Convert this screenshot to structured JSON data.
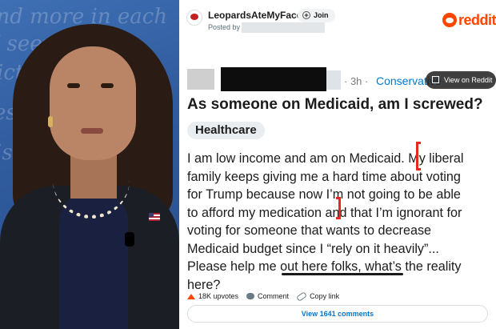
{
  "post": {
    "subreddit": "LeopardsAteMyFace",
    "join_label": "Join",
    "posted_by_label": "Posted by",
    "time_ago": "· 3h ·",
    "flair_subreddit": "Conservative",
    "view_on_reddit": "View on Reddit",
    "brand": "reddit",
    "title": "As someone on Medicaid, am I screwed?",
    "tag": "Healthcare",
    "body_lines": [
      "I am low income and am on Medicaid. My liberal",
      "family keeps giving me a hard time about voting",
      "for Trump because now I’m not going to be able",
      "to afford my medication and that I’m ignorant for",
      "voting for someone that wants to decrease",
      "Medicaid budget since I “rely on it heavily”...",
      "Please help me out here folks, what’s the reality",
      "here?"
    ],
    "upvotes": "18K upvotes",
    "comment_label": "Comment",
    "copy_link_label": "Copy link",
    "view_comments": "View 1641 comments"
  },
  "colors": {
    "reddit_orange": "#ff4500",
    "link_blue": "#0079d3",
    "annotation_red": "#e8281e"
  },
  "icons": [
    "plus-icon",
    "reddit-snoo-icon",
    "expand-icon",
    "upvote-icon",
    "comment-icon",
    "link-icon"
  ]
}
